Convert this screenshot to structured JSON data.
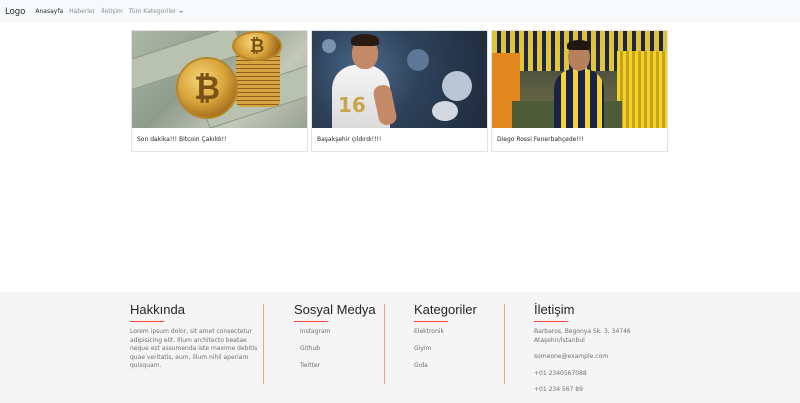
{
  "navbar": {
    "brand": "Logo",
    "links": [
      {
        "label": "Anasayfa",
        "active": true
      },
      {
        "label": "Haberler",
        "active": false
      },
      {
        "label": "İletişim",
        "active": false
      },
      {
        "label": "Tüm Kategoriler",
        "active": false
      }
    ]
  },
  "cards": [
    {
      "title": "Son dakika!!! Bitcoin Çakıldı!!"
    },
    {
      "title": "Başakşehir çıldırdı!!!!"
    },
    {
      "title": "Diego Rossi Fenerbahçede!!!"
    }
  ],
  "footer": {
    "about": {
      "heading": "Hakkında",
      "text": " Lorem ipsum dolor, sit amet consectetur adipisicing elit. Illum architecto beatae neque est assumenda iste maxime debitis quae veritatis, eum, illum nihil aperiam quisquam."
    },
    "social": {
      "heading": "Sosyal Medya",
      "items": [
        "Instagram",
        "Github",
        "Twitter"
      ]
    },
    "categories": {
      "heading": "Kategoriler",
      "items": [
        "Elektronik",
        "Giyim",
        "Gıda"
      ]
    },
    "contact": {
      "heading": "İletişim",
      "address_line1": "Barbaros, Begonya Sk. 3, 34746",
      "address_line2": " Ataşehir/İstanbul",
      "email": "someone@example.com",
      "phone1": "+01 2340567088",
      "phone2": "+01 234 567 89"
    }
  },
  "colors": {
    "accent": "#ff4136",
    "divider": "#f2a08b",
    "footer_bg": "#f5f5f5",
    "navbar_bg": "#f8f9fa"
  }
}
